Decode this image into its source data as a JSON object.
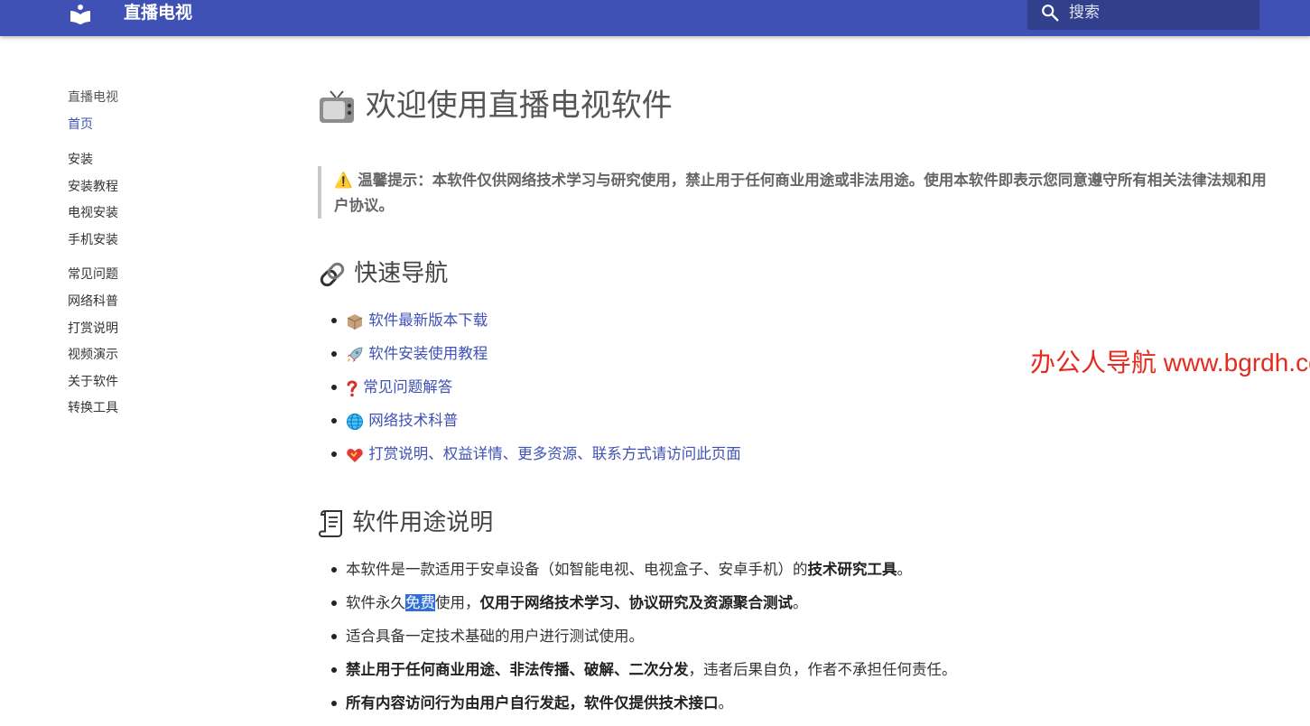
{
  "header": {
    "site_title": "直播电视",
    "logo_icon": "book-icon",
    "search": {
      "placeholder": "搜索",
      "icon": "search-icon"
    },
    "colors": {
      "primary": "#3f51b5"
    }
  },
  "sidebar": {
    "title": "直播电视",
    "home": "首页",
    "install_section": "安装",
    "install_items": [
      "安装教程",
      "电视安装",
      "手机安装"
    ],
    "other_items": [
      "常见问题",
      "网络科普",
      "打赏说明",
      "视频演示",
      "关于软件",
      "转换工具"
    ]
  },
  "main": {
    "title": "欢迎使用直播电视软件",
    "title_icon": "television-icon",
    "notice": "⚠️ 温馨提示：本软件仅供网络技术学习与研究使用，禁止用于任何商业用途或非法用途。使用本软件即表示您同意遵守所有相关法律法规和用户协议。",
    "quick_nav": {
      "heading": "快速导航",
      "icon": "link-icon",
      "items": [
        {
          "icon": "package-icon",
          "label": "软件最新版本下载"
        },
        {
          "icon": "rocket-icon",
          "label": "软件安装使用教程"
        },
        {
          "icon": "question-icon",
          "label": "常见问题解答"
        },
        {
          "icon": "globe-icon",
          "label": "网络技术科普"
        },
        {
          "icon": "heart-icon",
          "label": "打赏说明、权益详情、更多资源、联系方式请访问此页面"
        }
      ]
    },
    "usage": {
      "heading": "软件用途说明",
      "icon": "scroll-icon",
      "item1": {
        "text": "本软件是一款适用于安卓设备（如智能电视、电视盒子、安卓手机）的",
        "bold": "技术研究工具",
        "end": "。"
      },
      "item2": {
        "pre": "软件永久",
        "selected": "免费",
        "mid": "使用，",
        "bold": "仅用于网络技术学习、协议研究及资源聚合测试",
        "end": "。"
      },
      "item3": {
        "text": "适合具备一定技术基础的用户进行测试使用。"
      },
      "item4": {
        "bold": "禁止用于任何商业用途、非法传播、破解、二次分发",
        "text": "，违者后果自负，作者不承担任何责任。"
      },
      "item5": {
        "bold": "所有内容访问行为由用户自行发起，软件仅提供技术接口",
        "end": "。"
      }
    },
    "watermark": "办公人导航  www.bgrdh.com"
  }
}
